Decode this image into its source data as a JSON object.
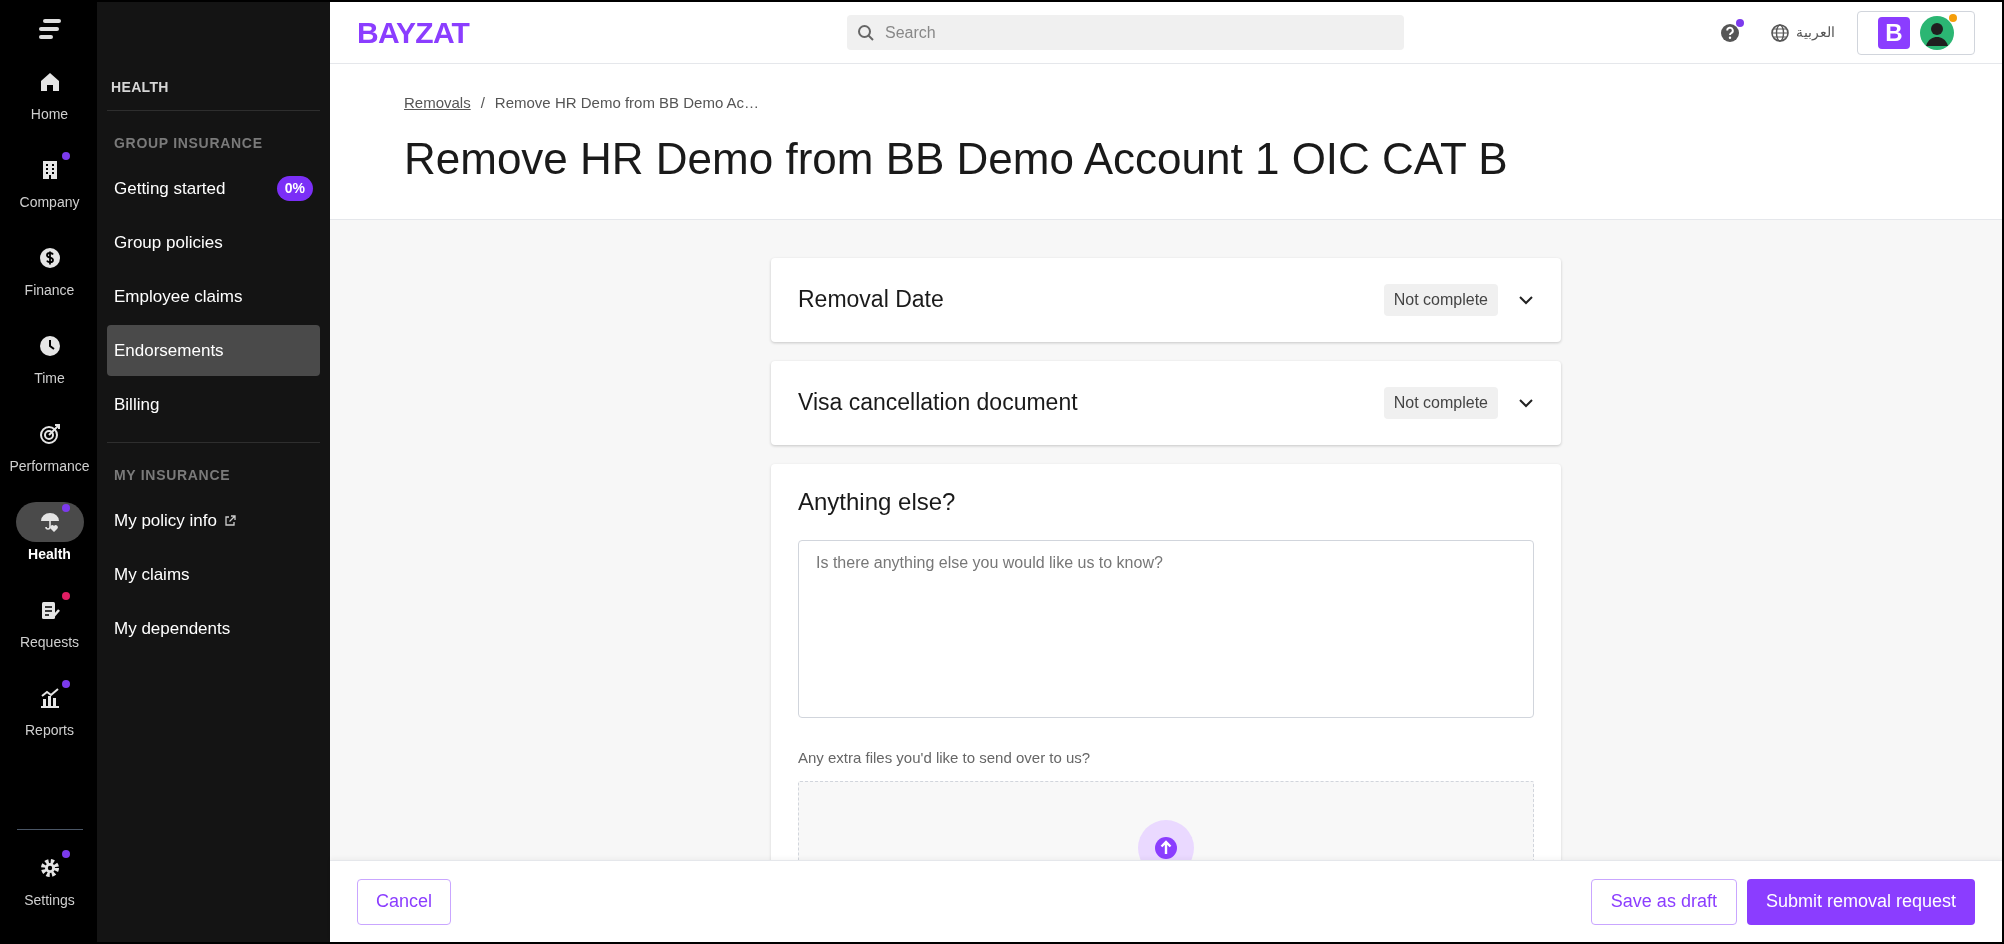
{
  "rail": {
    "items": [
      {
        "label": "Home",
        "selected": false
      },
      {
        "label": "Company",
        "selected": false,
        "color": "#7c3aed"
      },
      {
        "label": "Finance",
        "selected": false
      },
      {
        "label": "Time",
        "selected": false
      },
      {
        "label": "Performance",
        "selected": false
      },
      {
        "label": "Health",
        "selected": true,
        "color": "#7c3aed"
      },
      {
        "label": "Requests",
        "selected": false,
        "color": "#e11d63"
      },
      {
        "label": "Reports",
        "selected": false,
        "color": "#7c3aed"
      }
    ],
    "settings": {
      "label": "Settings",
      "color": "#7c3aed"
    }
  },
  "sidebar": {
    "title": "HEALTH",
    "sections": [
      {
        "heading": "GROUP INSURANCE",
        "items": [
          {
            "label": "Getting started",
            "selected": false,
            "badge": "0%"
          },
          {
            "label": "Group policies",
            "selected": false
          },
          {
            "label": "Employee claims",
            "selected": false
          },
          {
            "label": "Endorsements",
            "selected": true
          },
          {
            "label": "Billing",
            "selected": false
          }
        ]
      },
      {
        "heading": "MY INSURANCE",
        "items": [
          {
            "label": "My policy info",
            "selected": false,
            "external": true
          },
          {
            "label": "My claims",
            "selected": false
          },
          {
            "label": "My dependents",
            "selected": false
          }
        ]
      }
    ]
  },
  "topbar": {
    "logo": "BAYZAT",
    "search": {
      "placeholder": "Search"
    },
    "language": "العربية",
    "company_initial": "B"
  },
  "breadcrumb": {
    "separator": "/",
    "items": [
      {
        "label": "Removals",
        "link": true
      },
      {
        "label": "Remove HR Demo from BB Demo Ac…",
        "link": false
      }
    ]
  },
  "title": "Remove HR Demo from BB Demo Account 1 OIC CAT B",
  "sections": [
    {
      "title": "Removal Date",
      "status": "Not complete",
      "expanded": false
    },
    {
      "title": "Visa cancellation document",
      "status": "Not complete",
      "expanded": false
    }
  ],
  "extra": {
    "title": "Anything else?",
    "placeholder": "Is there anything else you would like us to know?",
    "files_label": "Any extra files you'd like to send over to us?"
  },
  "footer": {
    "cancel": "Cancel",
    "draft": "Save as draft",
    "submit": "Submit removal request"
  }
}
